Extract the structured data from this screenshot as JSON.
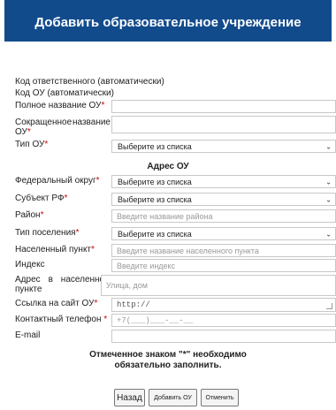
{
  "header": {
    "title": "Добавить образовательное учреждение"
  },
  "auto_fields": {
    "responsible_code": "Код ответственного (автоматически)",
    "ou_code": "Код ОУ (автоматически)"
  },
  "fields": {
    "full_name": {
      "label": "Полное название ОУ",
      "value": ""
    },
    "short_name": {
      "label_line1": "Сокращенное",
      "label_line1b": "название",
      "label_line2": "ОУ",
      "value": ""
    },
    "ou_type": {
      "label": "Тип ОУ",
      "value": "Выберите из списка"
    }
  },
  "address_section": {
    "title": "Адрес ОУ",
    "federal_district": {
      "label": "Федеральный округ",
      "value": "Выберите из списка"
    },
    "subject": {
      "label": "Субъект РФ",
      "value": "Выберите из списка"
    },
    "district": {
      "label": "Район",
      "placeholder": "Введите название района"
    },
    "settlement_type": {
      "label": "Тип поселения",
      "value": "Выберите из списка"
    },
    "settlement": {
      "label": "Населенный пункт",
      "placeholder": "Введите название населенного пункта"
    },
    "index": {
      "label": "Индекс",
      "placeholder": "Введите индекс"
    },
    "address": {
      "label_w1": "Адрес",
      "label_w2": "в",
      "label_w3": "населенном",
      "label_line2": "пункте",
      "placeholder": "Улица, дом"
    },
    "site_link": {
      "label": "Ссылка на сайт ОУ",
      "value": "http://"
    },
    "phone": {
      "label": "Контактный телефон ",
      "placeholder": "+7(___)___-__-__"
    },
    "email": {
      "label": "E-mail",
      "value": ""
    }
  },
  "required_mark": "*",
  "note": {
    "line1": "Отмеченное знаком \"*\" необходимо",
    "line2": "обязательно заполнить."
  },
  "buttons": {
    "back": "Назад",
    "add": "Добавить ОУ",
    "cancel": "Отменить"
  },
  "icons": {
    "dropdown": "chevron-down-icon",
    "resize": "resize-handle-icon"
  },
  "colors": {
    "header_bg": "#124b8c",
    "required": "#d00000"
  }
}
